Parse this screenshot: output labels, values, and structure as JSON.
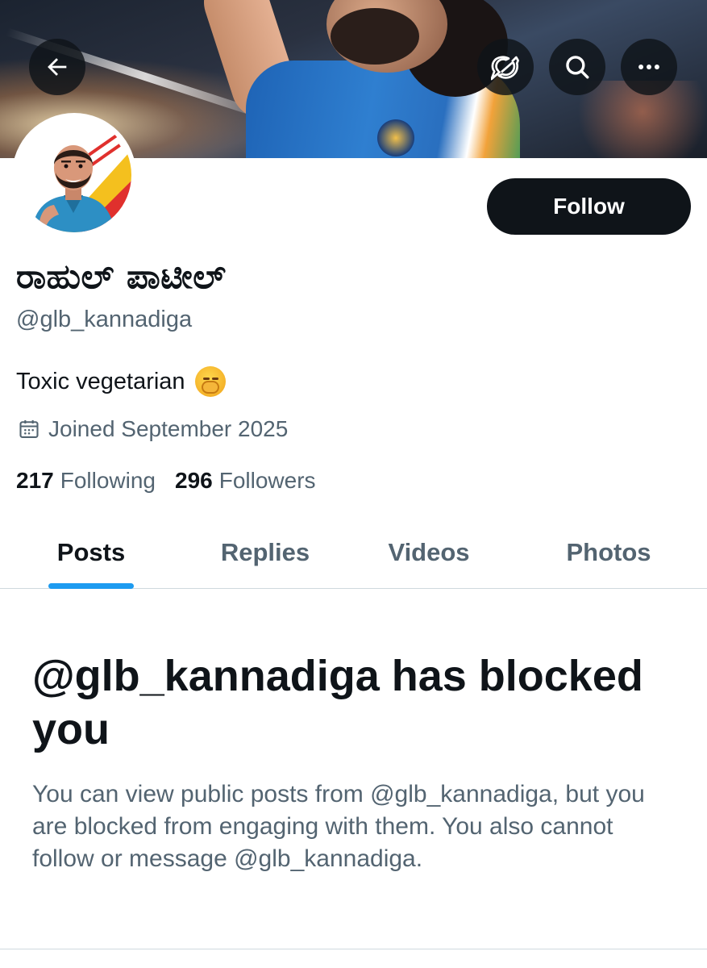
{
  "header": {
    "back_icon": "arrow-left-icon",
    "grok_icon": "grok-icon",
    "search_icon": "search-icon",
    "more_icon": "more-horizontal-icon"
  },
  "profile": {
    "display_name": "ರಾಹುಲ್ ಪಾಟೀಲ್",
    "handle": "@glb_kannadiga",
    "bio": "Toxic vegetarian",
    "bio_emoji": "yawning-face-emoji",
    "joined": "Joined September 2025",
    "follow_label": "Follow",
    "following_count": "217",
    "following_label": "Following",
    "followers_count": "296",
    "followers_label": "Followers"
  },
  "tabs": [
    {
      "label": "Posts",
      "active": true
    },
    {
      "label": "Replies",
      "active": false
    },
    {
      "label": "Videos",
      "active": false
    },
    {
      "label": "Photos",
      "active": false
    }
  ],
  "blocked": {
    "title": "@glb_kannadiga has blocked you",
    "description": "You can view public posts from @glb_kannadiga, but you are blocked from engaging with them. You also cannot follow or message @glb_kannadiga."
  },
  "colors": {
    "accent": "#1d9bf0",
    "text_primary": "#0f1419",
    "text_secondary": "#536471"
  }
}
